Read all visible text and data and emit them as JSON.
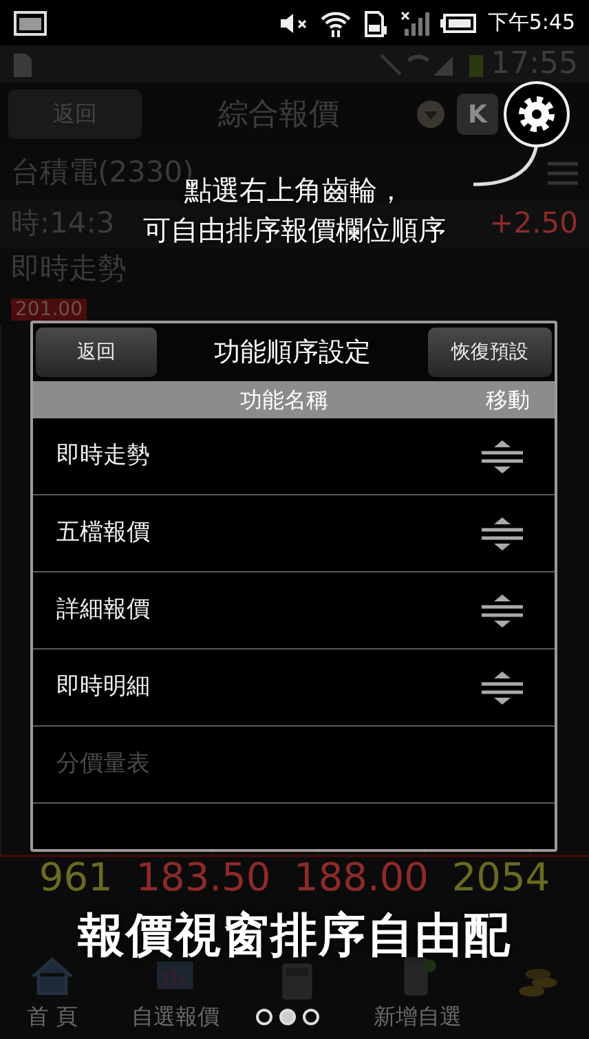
{
  "status_bar": {
    "time": "下午5:45"
  },
  "background_app": {
    "inner_status_time": "17:55",
    "back_button": "返回",
    "title": "綜合報價",
    "k_button": "K",
    "stock_name": "台積電(2330)",
    "time_label": "時:14:3",
    "change": "+2.50",
    "section": "即時走勢",
    "price_tag": "201.00",
    "quote_row": [
      "961",
      "183.50",
      "188.00",
      "2054"
    ],
    "nav": [
      {
        "kind": "labeled",
        "label": "首 頁"
      },
      {
        "kind": "labeled",
        "label": "自選報價"
      },
      {
        "kind": "icon"
      },
      {
        "kind": "labeled",
        "label": "新增自選"
      },
      {
        "kind": "icon"
      }
    ]
  },
  "tip": {
    "lines": [
      "點選右上角齒輪，",
      "可自由排序報價欄位順序"
    ]
  },
  "dialog": {
    "back_button": "返回",
    "title": "功能順序設定",
    "reset_button": "恢復預設",
    "columns": [
      "功能名稱",
      "移動"
    ],
    "rows": [
      {
        "name": "即時走勢",
        "enabled": true
      },
      {
        "name": "五檔報價",
        "enabled": true
      },
      {
        "name": "詳細報價",
        "enabled": true
      },
      {
        "name": "即時明細",
        "enabled": true
      },
      {
        "name": "分價量表",
        "enabled": false
      }
    ]
  },
  "caption": "報價視窗排序自由配",
  "pager": [
    {
      "selected": false
    },
    {
      "selected": true
    },
    {
      "selected": false
    }
  ]
}
